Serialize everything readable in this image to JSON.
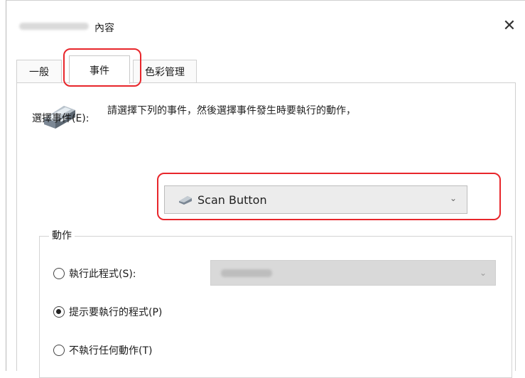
{
  "window": {
    "title": "內容",
    "close_icon": "close-icon"
  },
  "tabs": [
    {
      "label": "一般"
    },
    {
      "label": "事件"
    },
    {
      "label": "色彩管理"
    }
  ],
  "events_tab": {
    "instruction": "請選擇下列的事件，然後選擇事件發生時要執行的動作，",
    "select_event_label": "選擇事件(E):",
    "selected_event": "Scan Button",
    "select_event_icon": "scanner-icon"
  },
  "actions": {
    "legend": "動作",
    "options": [
      {
        "label": "執行此程式(S):",
        "checked": false
      },
      {
        "label": "提示要執行的程式(P)",
        "checked": true
      },
      {
        "label": "不執行任何動作(T)",
        "checked": false
      }
    ]
  },
  "colors": {
    "highlight": "#e8262b"
  }
}
